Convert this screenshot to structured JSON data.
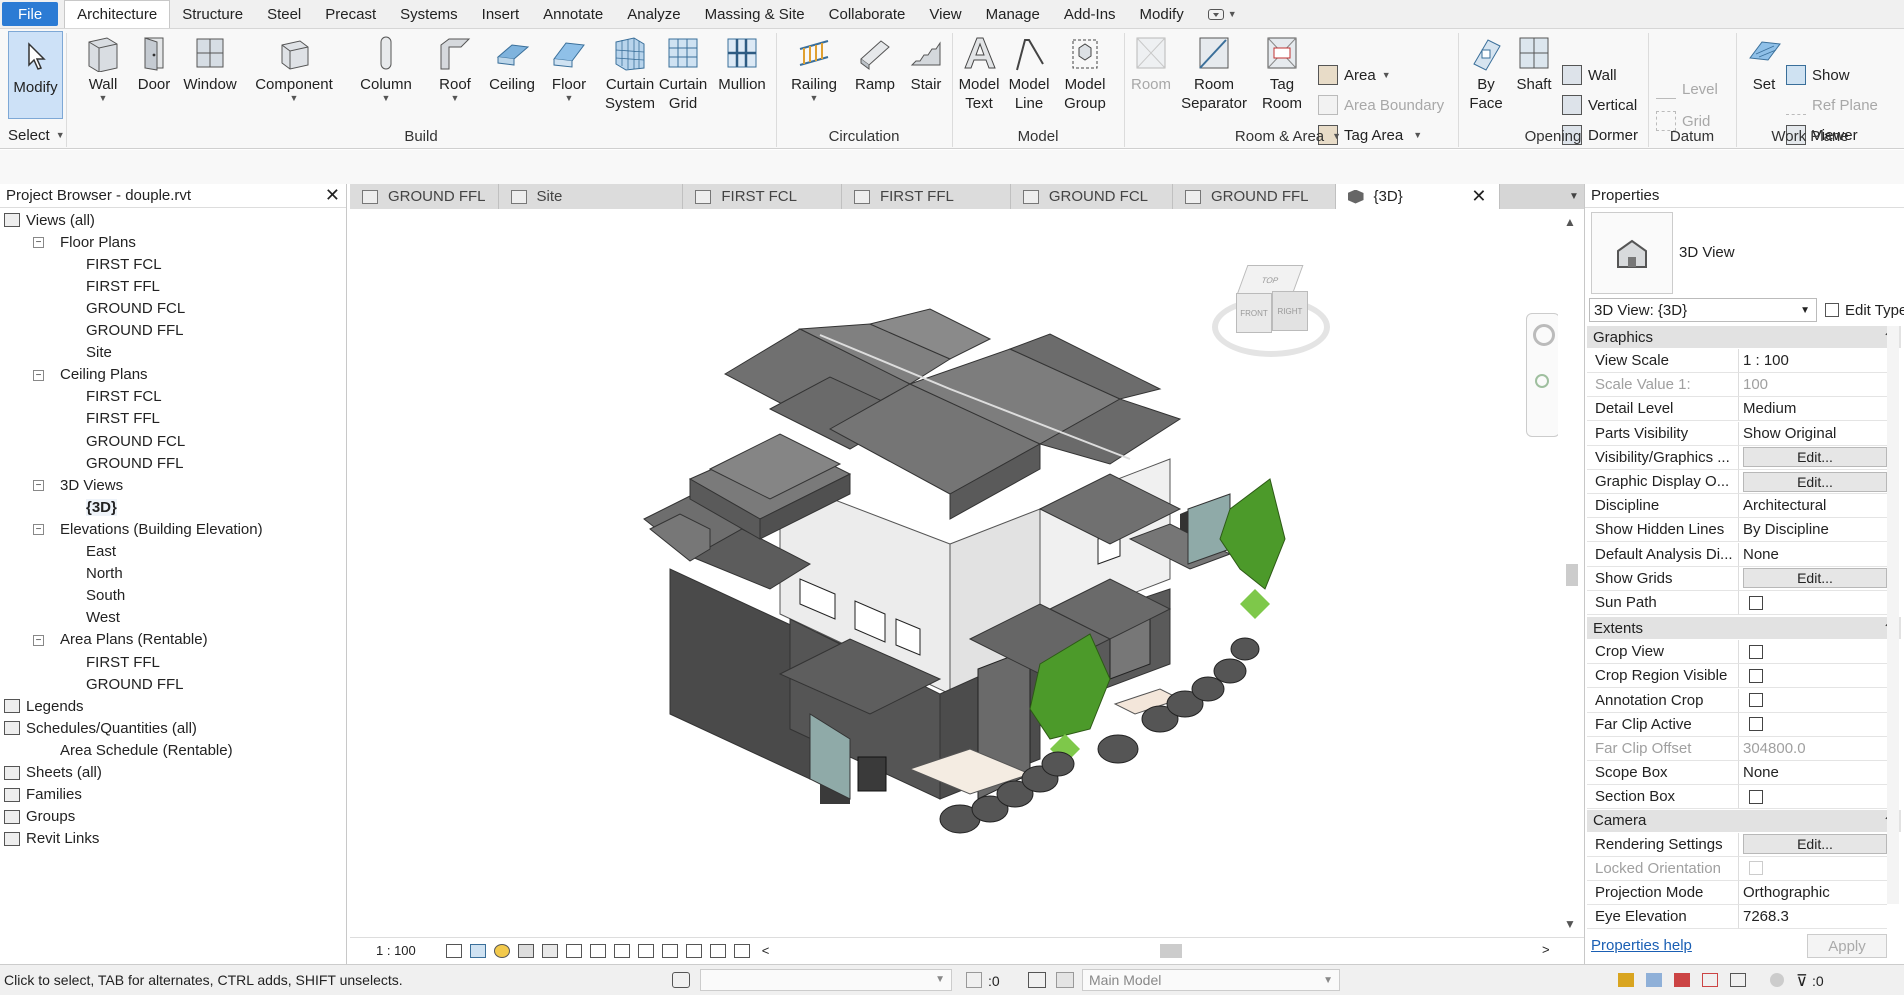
{
  "menu": {
    "items": [
      "File",
      "Architecture",
      "Structure",
      "Steel",
      "Precast",
      "Systems",
      "Insert",
      "Annotate",
      "Analyze",
      "Massing & Site",
      "Collaborate",
      "View",
      "Manage",
      "Add-Ins",
      "Modify"
    ],
    "active": "Architecture"
  },
  "ribbon": {
    "select": {
      "modify": "Modify",
      "select_label": "Select"
    },
    "build": {
      "label": "Build",
      "wall": "Wall",
      "door": "Door",
      "window": "Window",
      "component": "Component",
      "column": "Column",
      "roof": "Roof",
      "ceiling": "Ceiling",
      "floor": "Floor",
      "curtain_system": [
        "Curtain",
        "System"
      ],
      "curtain_grid": [
        "Curtain",
        "Grid"
      ],
      "mullion": "Mullion"
    },
    "circulation": {
      "label": "Circulation",
      "railing": "Railing",
      "ramp": "Ramp",
      "stair": "Stair"
    },
    "model": {
      "label": "Model",
      "model_text": [
        "Model",
        "Text"
      ],
      "model_line": [
        "Model",
        "Line"
      ],
      "model_group": [
        "Model",
        "Group"
      ]
    },
    "room_area": {
      "label": "Room & Area",
      "room": "Room",
      "room_separator": [
        "Room",
        "Separator"
      ],
      "tag_room": [
        "Tag",
        "Room"
      ],
      "area": "Area",
      "area_boundary": "Area  Boundary",
      "tag_area": "Tag  Area"
    },
    "opening": {
      "label": "Opening",
      "by_face": [
        "By",
        "Face"
      ],
      "shaft": "Shaft",
      "wall": "Wall",
      "vertical": "Vertical",
      "dormer": "Dormer"
    },
    "datum": {
      "label": "Datum",
      "level": "Level",
      "grid": "Grid"
    },
    "work_plane": {
      "label": "Work Plane",
      "set": "Set",
      "show": "Show",
      "ref_plane": "Ref  Plane",
      "viewer": "Viewer"
    }
  },
  "project_browser": {
    "title": "Project Browser - douple.rvt",
    "tree": [
      {
        "label": "Views (all)",
        "level": 0
      },
      {
        "label": "Floor Plans",
        "level": 1
      },
      {
        "label": "FIRST FCL",
        "level": 2
      },
      {
        "label": "FIRST FFL",
        "level": 2
      },
      {
        "label": "GROUND FCL",
        "level": 2
      },
      {
        "label": "GROUND FFL",
        "level": 2
      },
      {
        "label": "Site",
        "level": 2
      },
      {
        "label": "Ceiling Plans",
        "level": 1
      },
      {
        "label": "FIRST FCL",
        "level": 2
      },
      {
        "label": "FIRST FFL",
        "level": 2
      },
      {
        "label": "GROUND FCL",
        "level": 2
      },
      {
        "label": "GROUND FFL",
        "level": 2
      },
      {
        "label": "3D Views",
        "level": 1
      },
      {
        "label": "{3D}",
        "level": 2
      },
      {
        "label": "Elevations (Building Elevation)",
        "level": 1
      },
      {
        "label": "East",
        "level": 2
      },
      {
        "label": "North",
        "level": 2
      },
      {
        "label": "South",
        "level": 2
      },
      {
        "label": "West",
        "level": 2
      },
      {
        "label": "Area Plans (Rentable)",
        "level": 1
      },
      {
        "label": "FIRST FFL",
        "level": 2
      },
      {
        "label": "GROUND FFL",
        "level": 2
      },
      {
        "label": "Legends",
        "level": 0
      },
      {
        "label": "Schedules/Quantities (all)",
        "level": 0
      },
      {
        "label": "Area Schedule (Rentable)",
        "level": 1
      },
      {
        "label": "Sheets (all)",
        "level": 0
      },
      {
        "label": "Families",
        "level": 0
      },
      {
        "label": "Groups",
        "level": 0
      },
      {
        "label": "Revit Links",
        "level": 0
      }
    ]
  },
  "view_tabs": [
    "GROUND FFL",
    "Site",
    "FIRST FCL",
    "FIRST FFL",
    "GROUND FCL",
    "GROUND FFL",
    "{3D}"
  ],
  "active_tab": "{3D}",
  "viewcube": {
    "top": "TOP",
    "front": "FRONT",
    "right": "RIGHT"
  },
  "view_bar": {
    "scale": "1 : 100"
  },
  "properties": {
    "title": "Properties",
    "type_name": "3D View",
    "selector": "3D View: {3D}",
    "edit_type": "Edit Type",
    "sections": {
      "graphics": "Graphics",
      "extents": "Extents",
      "camera": "Camera"
    },
    "graphics_rows": [
      {
        "name": "View Scale",
        "value": "1 : 100"
      },
      {
        "name": "Scale Value    1:",
        "value": "100"
      },
      {
        "name": "Detail Level",
        "value": "Medium"
      },
      {
        "name": "Parts Visibility",
        "value": "Show Original"
      },
      {
        "name": "Visibility/Graphics ...",
        "value": "Edit..."
      },
      {
        "name": "Graphic Display O...",
        "value": "Edit..."
      },
      {
        "name": "Discipline",
        "value": "Architectural"
      },
      {
        "name": "Show Hidden Lines",
        "value": "By Discipline"
      },
      {
        "name": "Default Analysis Di...",
        "value": "None"
      },
      {
        "name": "Show Grids",
        "value": "Edit..."
      },
      {
        "name": "Sun Path",
        "value": ""
      }
    ],
    "extents_rows": [
      {
        "name": "Crop View",
        "value": ""
      },
      {
        "name": "Crop Region Visible",
        "value": ""
      },
      {
        "name": "Annotation Crop",
        "value": ""
      },
      {
        "name": "Far Clip Active",
        "value": ""
      },
      {
        "name": "Far Clip Offset",
        "value": "304800.0"
      },
      {
        "name": "Scope Box",
        "value": "None"
      },
      {
        "name": "Section Box",
        "value": ""
      }
    ],
    "camera_rows": [
      {
        "name": "Rendering Settings",
        "value": "Edit..."
      },
      {
        "name": "Locked Orientation",
        "value": ""
      },
      {
        "name": "Projection Mode",
        "value": "Orthographic"
      },
      {
        "name": "Eye Elevation",
        "value": "7268.3"
      }
    ],
    "help": "Properties help",
    "apply": "Apply"
  },
  "status": {
    "message": "Click to select, TAB for alternates, CTRL adds, SHIFT unselects.",
    "count": ":0",
    "model": "Main Model",
    "filter_count": ":0"
  }
}
